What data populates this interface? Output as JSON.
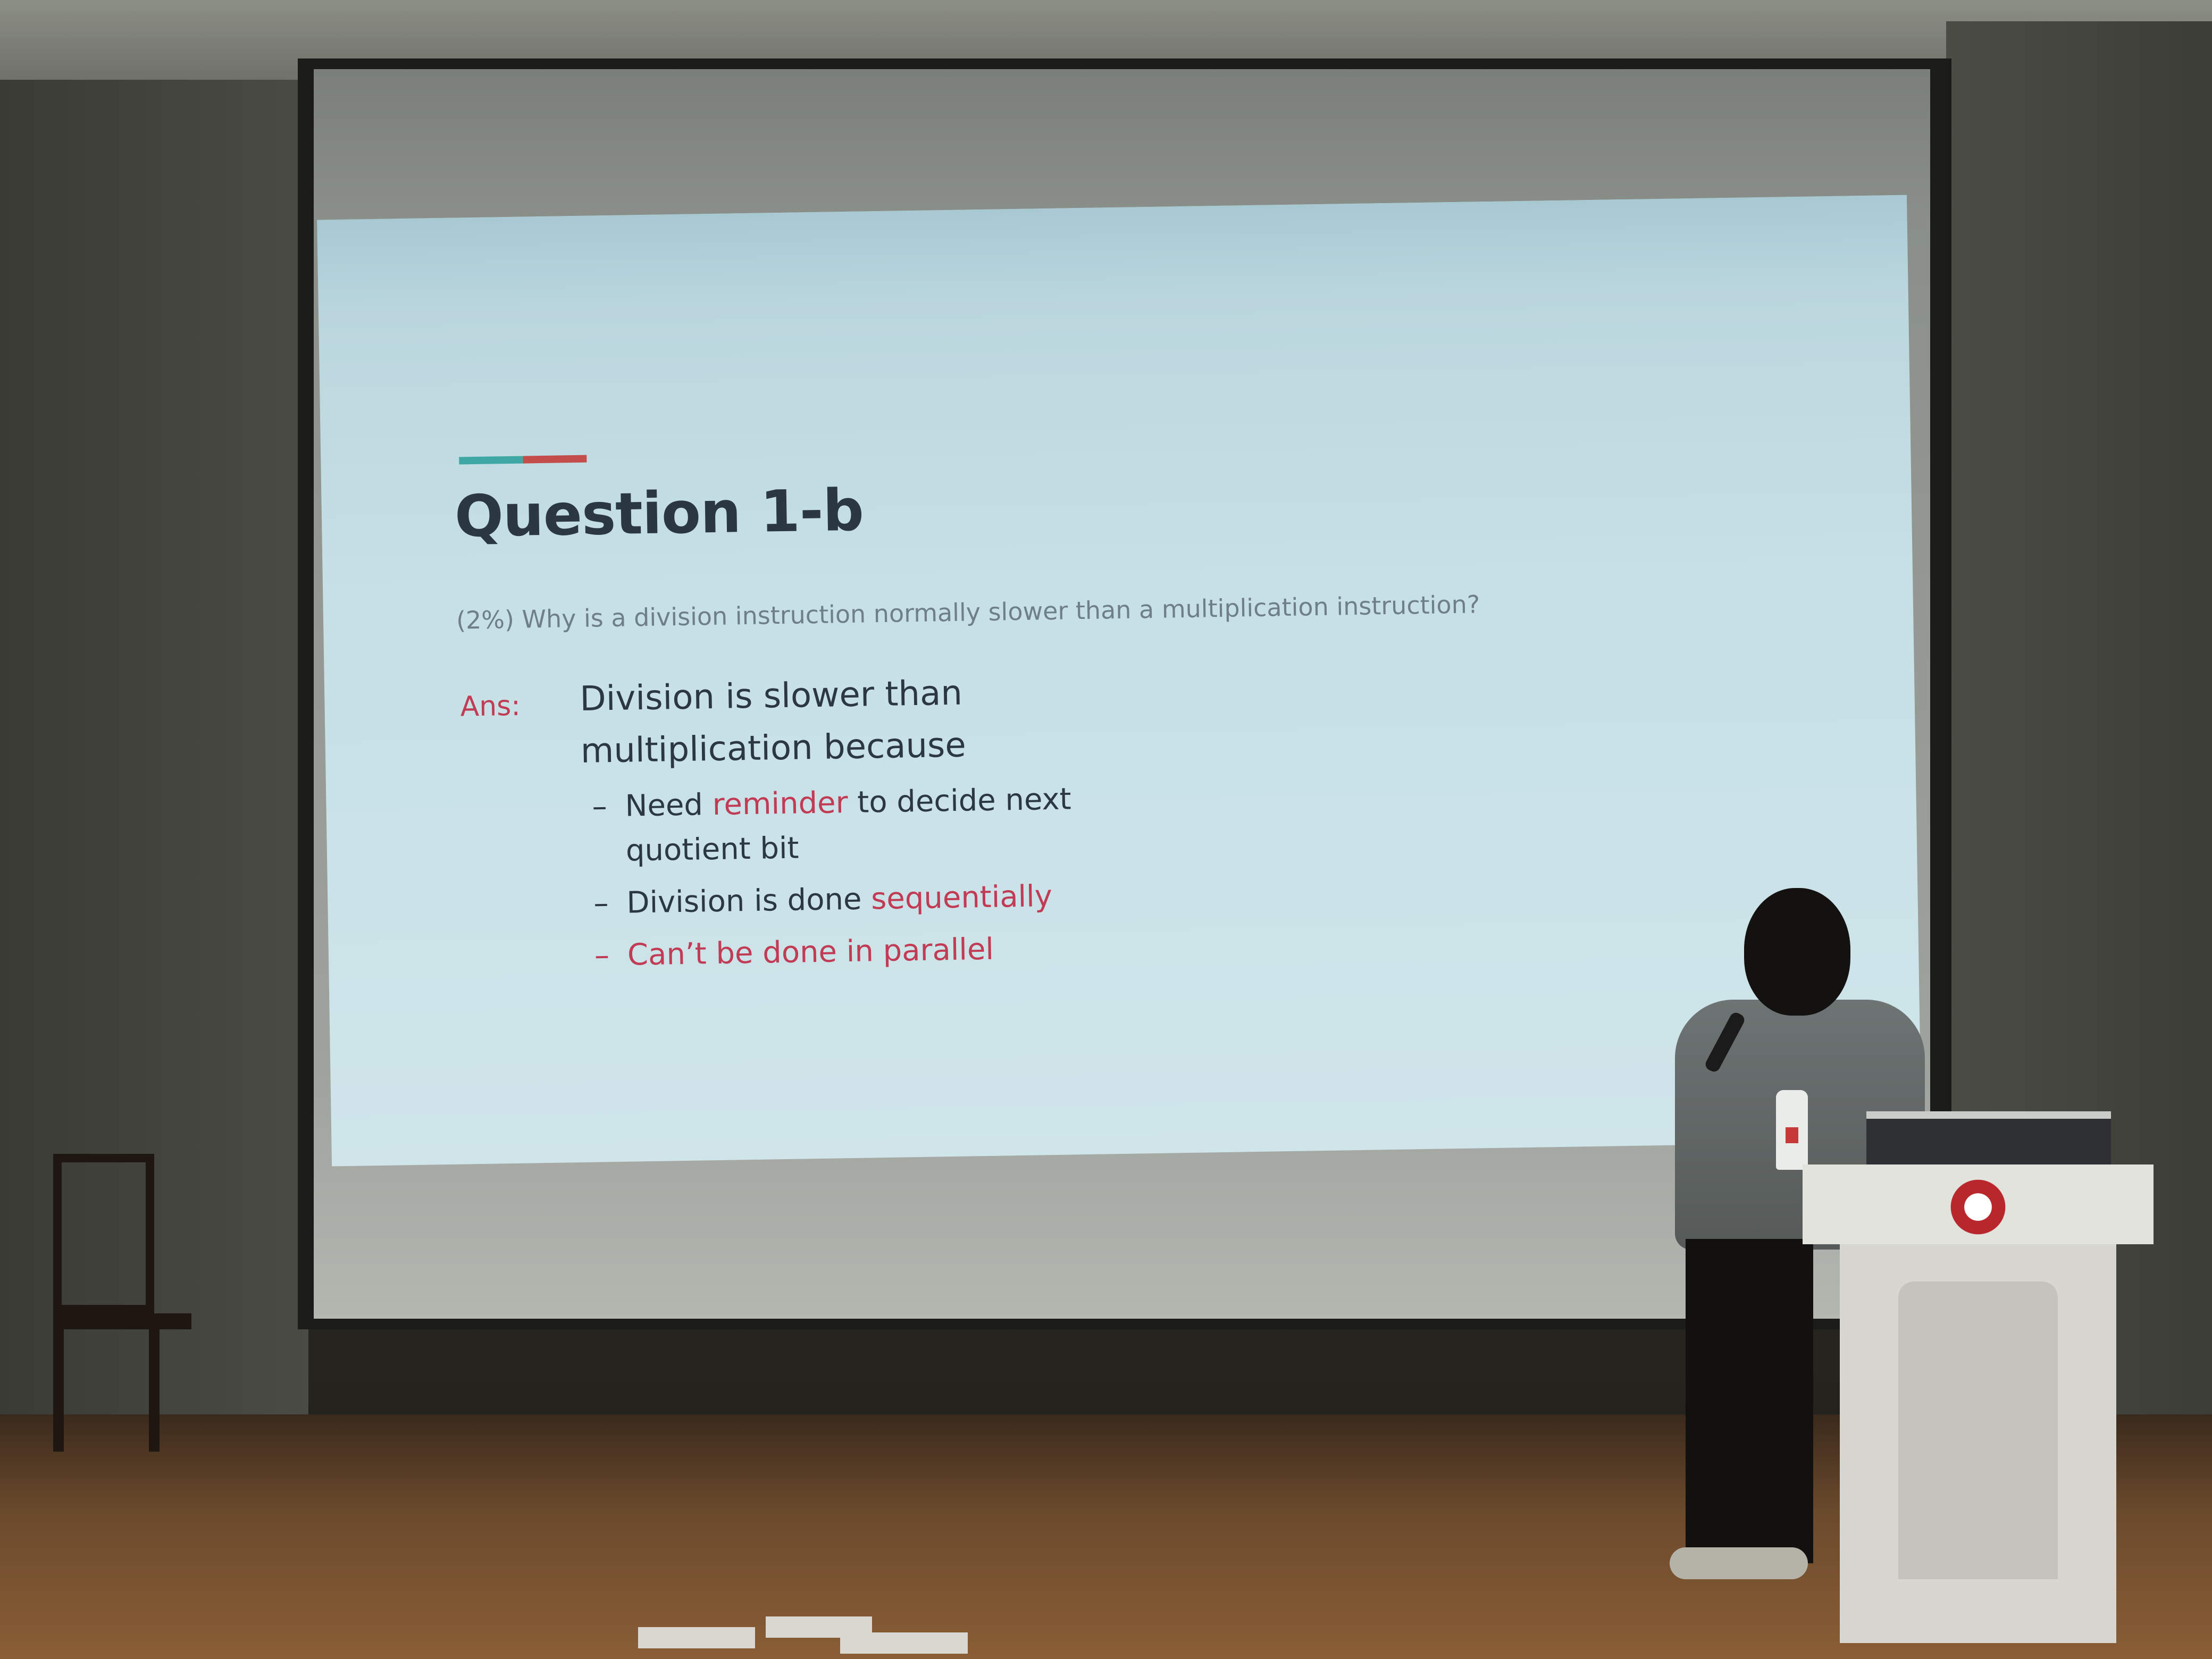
{
  "slide": {
    "title": "Question 1-b",
    "question": "(2%) Why is a division instruction normally slower than a multiplication instruction?",
    "ans_label": "Ans:",
    "ans_line1": "Division is slower than",
    "ans_line2": "multiplication because",
    "bullets": {
      "b1_pre": "Need",
      "b1_red": "reminder",
      "b1_post": "to decide next",
      "b1_line2": "quotient bit",
      "b2_pre": "Division is done",
      "b2_red": "sequentially",
      "b3_red": "Can’t be done in parallel"
    },
    "dash": "–"
  },
  "colors": {
    "slide_bg": "#c6e0e6",
    "title": "#2b3743",
    "highlight": "#c23b55",
    "accent_teal": "#3fa7a4",
    "accent_red": "#c24d4a"
  }
}
